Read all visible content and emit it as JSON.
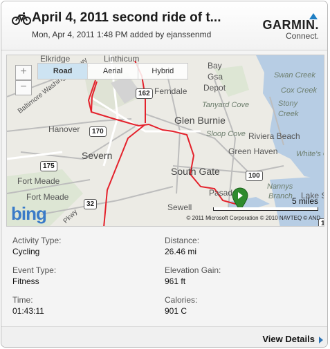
{
  "header": {
    "title": "April 4, 2011 second ride of t...",
    "subtitle": "Mon, Apr 4, 2011 1:48 PM added by ejanssenmd",
    "logo_main": "GARMIN.",
    "logo_sub": "Connect."
  },
  "map": {
    "tabs": [
      "Road",
      "Aerial",
      "Hybrid"
    ],
    "active_tab": "Road",
    "zoom_in": "+",
    "zoom_out": "−",
    "scale_label": "5 miles",
    "copyright": "© 2011 Microsoft Corporation   © 2010 NAVTEQ   © AND",
    "provider": "bing",
    "route_color": "#e4212b",
    "places": {
      "elkridge": "Elkridge",
      "linthicum": "Linthicum",
      "ferndale": "Ferndale",
      "glen_burnie": "Glen Burnie",
      "hanover": "Hanover",
      "severn": "Severn",
      "south_gate": "South Gate",
      "fort_meade_1": "Fort Meade",
      "fort_meade_2": "Fort Meade",
      "green_haven": "Green Haven",
      "riviera_beach": "Riviera Beach",
      "pasadena": "Pasad",
      "sewell": "Sewell",
      "bay": "Bay",
      "gsa": "Gsa",
      "depot": "Depot",
      "swan_creek": "Swan Creek",
      "cox_creek": "Cox Creek",
      "stony_creek": "Stony",
      "stony_creek_2": "Creek",
      "tanyard_cove": "Tanyard Cove",
      "sloop_cove": "Sloop Cove",
      "whites_cove": "White's C",
      "nannys": "Nannys",
      "branch": "Branch",
      "lake_s": "Lake S",
      "bw_pkwy": "Baltimore Washington Pkwy",
      "rte_pkwy": "Pkwy"
    },
    "shields": {
      "s162": "162",
      "s170": "170",
      "s175": "175",
      "s32": "32",
      "s100": "100",
      "s10": "10"
    }
  },
  "stats": {
    "activity_type_label": "Activity Type:",
    "activity_type": "Cycling",
    "event_type_label": "Event Type:",
    "event_type": "Fitness",
    "time_label": "Time:",
    "time": "01:43:11",
    "distance_label": "Distance:",
    "distance": "26.46 mi",
    "elevation_label": "Elevation Gain:",
    "elevation": "961 ft",
    "calories_label": "Calories:",
    "calories": "901 C"
  },
  "footer": {
    "view_details": "View Details"
  }
}
